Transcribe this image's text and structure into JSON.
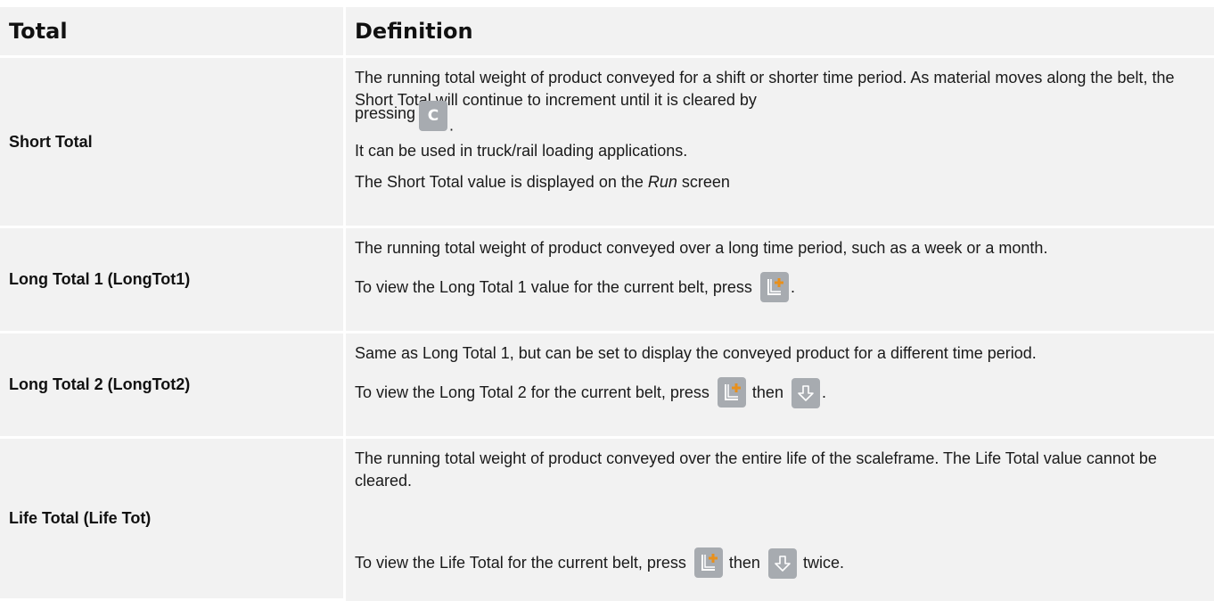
{
  "header": {
    "col1": "Total",
    "col2": "Definition"
  },
  "rows": [
    {
      "term": "Short Total",
      "p1": "The running total weight of product conveyed for a shift or shorter time period. As material moves along the belt, the Short Total will continue to increment until it is cleared by",
      "p2_before": "pressing",
      "p2_key": "C",
      "p2_after": ".",
      "p3": "It can be used in truck/rail loading applications.",
      "p4_before": "The Short Total value is displayed on the ",
      "p4_em": "Run",
      "p4_after": " screen"
    },
    {
      "term": "Long Total 1 (LongTot1)",
      "p1": "The running total weight of product conveyed over a long time period, such as a week or a month.",
      "p2_before": "To view the Long Total 1 value for the current belt, press",
      "p2_after": "."
    },
    {
      "term": "Long Total 2 (LongTot2)",
      "p1": "Same as Long Total 1, but can be set to display the conveyed product for a different time period.",
      "p2_before": "To view the Long Total 2 for the current belt, press",
      "p2_mid": "then",
      "p2_after": "."
    },
    {
      "term": "Life Total (Life Tot)",
      "p1": "The running total weight of product conveyed over the entire life of the scaleframe. The Life Total value cannot be cleared.",
      "p2_before": "To view the Life Total for the current belt, press",
      "p2_mid": "then",
      "p2_after": "twice."
    }
  ],
  "icons": {
    "clear_key": "clear-key-icon",
    "long_total_key": "long-total-key-icon",
    "down_arrow_key": "down-arrow-key-icon"
  },
  "colors": {
    "cell_bg": "#f2f2f2",
    "key_bg": "#a7abb0",
    "plus_accent": "#e8901c"
  }
}
